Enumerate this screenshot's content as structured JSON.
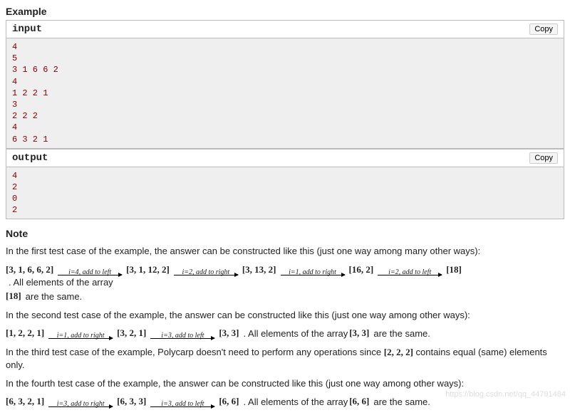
{
  "example": {
    "title": "Example",
    "input": {
      "label": "input",
      "copy": "Copy",
      "text": "4\n5\n3 1 6 6 2\n4\n1 2 2 1\n3\n2 2 2\n4\n6 3 2 1"
    },
    "output": {
      "label": "output",
      "copy": "Copy",
      "text": "4\n2\n0\n2"
    }
  },
  "note": {
    "title": "Note",
    "p1": "In the first test case of the example, the answer can be constructed like this (just one way among many other ways):",
    "p2": "In the second test case of the example, the answer can be constructed like this (just one way among other ways):",
    "p3a": "In the third test case of the example, Polycarp doesn't need to perform any operations since ",
    "p3b": " contains equal (same) elements only.",
    "p4": "In the fourth test case of the example, the answer can be constructed like this (just one way among other ways):",
    "arr222": "[2, 2, 2]"
  },
  "chains": {
    "c1": {
      "a0": "[3, 1, 6, 6, 2]",
      "s1": "i=4, add to left",
      "a1": "[3, 1, 12, 2]",
      "s2": "i=2, add to right",
      "a2": "[3, 13, 2]",
      "s3": "i=1, add to right",
      "a3": "[16, 2]",
      "s4": "i=2, add to left",
      "a4": "[18]",
      "tail1": ". All elements of the array",
      "a5": "[18]",
      "tail2": " are the same."
    },
    "c2": {
      "a0": "[1, 2, 2, 1]",
      "s1": "i=1, add to right",
      "a1": "[3, 2, 1]",
      "s2": "i=3, add to left",
      "a2": "[3, 3]",
      "tail1": ". All elements of the array ",
      "a3": "[3, 3]",
      "tail2": " are the same."
    },
    "c4": {
      "a0": "[6, 3, 2, 1]",
      "s1": "i=3, add to right",
      "a1": "[6, 3, 3]",
      "s2": "i=3, add to left",
      "a2": "[6, 6]",
      "tail1": ". All elements of the array ",
      "a3": "[6, 6]",
      "tail2": " are the same."
    }
  },
  "watermark": "https://blog.csdn.net/qq_44791484"
}
